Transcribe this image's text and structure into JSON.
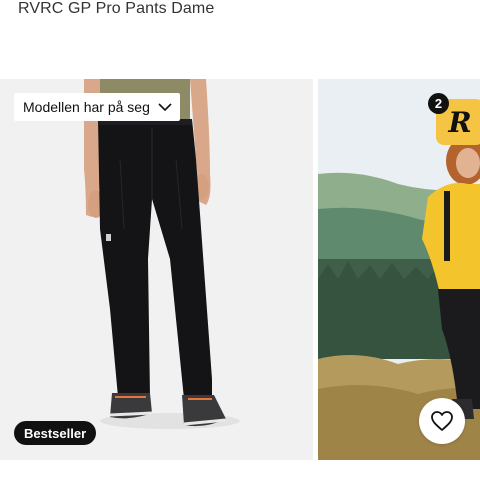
{
  "product": {
    "title": "RVRC GP Pro Pants Dame"
  },
  "slide1": {
    "model_size_label": "Modellen har på seg",
    "badge": "Bestseller"
  },
  "slide2": {
    "count": "2",
    "brand_letter": "R"
  },
  "icons": {
    "model_chevron": "chevron-down-icon",
    "wishlist": "heart-icon"
  },
  "colors": {
    "brand_yellow": "#f6c443",
    "badge_black": "#111111"
  }
}
